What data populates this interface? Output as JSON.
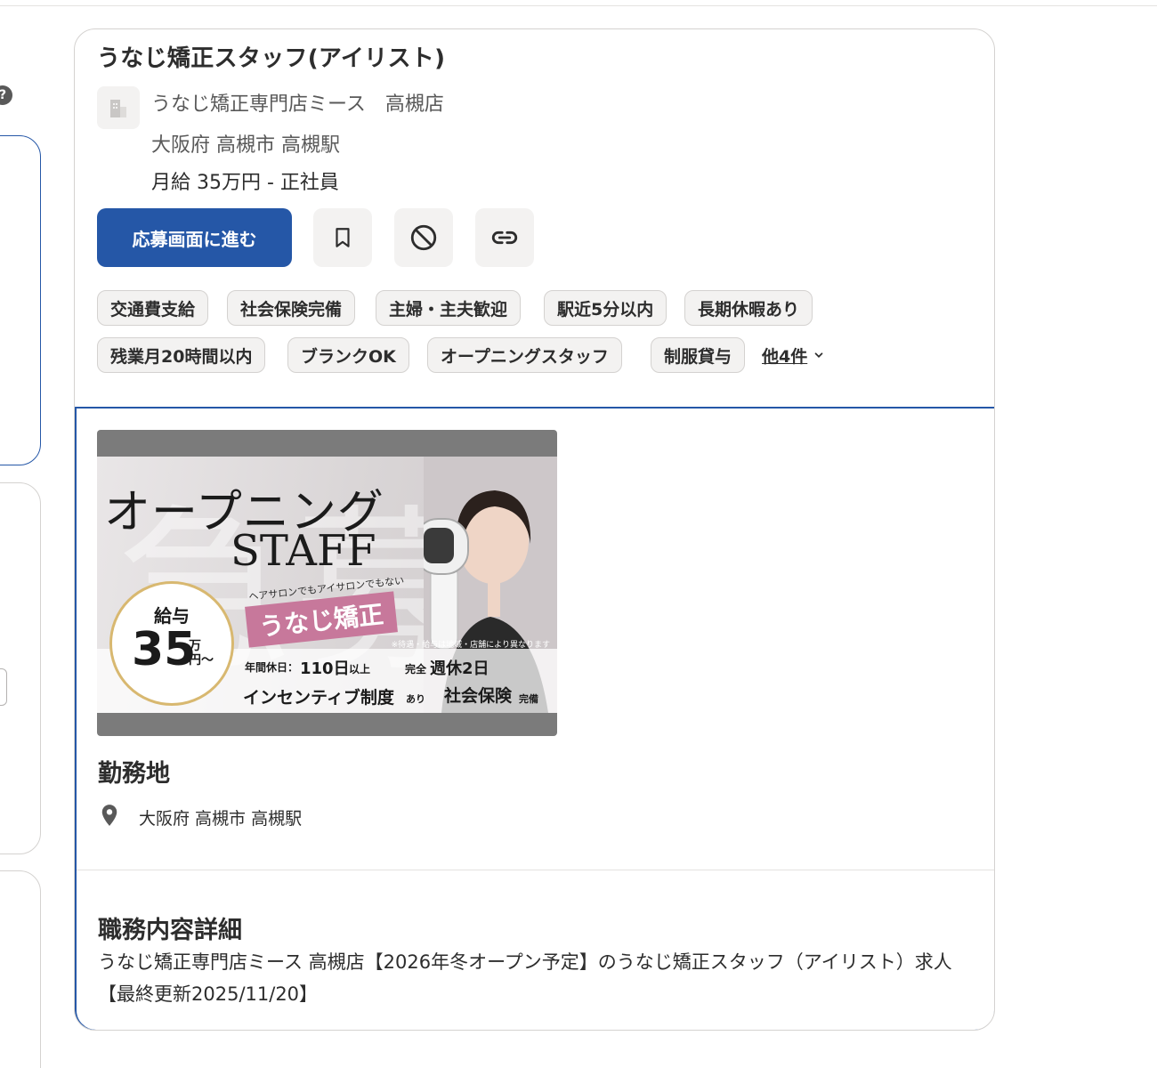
{
  "left_panel": {
    "help_icon": "?"
  },
  "job": {
    "title": "うなじ矯正スタッフ(アイリスト)",
    "company": "うなじ矯正専門店ミース　高槻店",
    "location": "大阪府 高槻市 高槻駅",
    "salary": "月給 35万円  - 正社員"
  },
  "actions": {
    "apply_label": "応募画面に進む",
    "save_icon": "bookmark-icon",
    "block_icon": "not-interested-icon",
    "share_icon": "link-icon"
  },
  "tags": [
    "交通費支給",
    "社会保険完備",
    "主婦・主夫歓迎",
    "駅近5分以内",
    "長期休暇あり",
    "残業月20時間以内",
    "ブランクOK",
    "オープニングスタッフ",
    "制服貸与"
  ],
  "more_tags": "他4件",
  "banner": {
    "headline": "オープニング",
    "staff": "STAFF",
    "sub": "ヘアサロンでもアイサロンでもない",
    "pink": "うなじ矯正",
    "note": "※待遇・給与は地域・店舗により異なります",
    "salary_label": "給与",
    "salary_value": "35",
    "salary_unit_1": "万",
    "salary_unit_2": "円〜",
    "holidays_prefix": "年間休日：",
    "holidays_value": "110日",
    "holidays_suffix": "以上",
    "weekly_prefix": "完全",
    "weekly_value": "週休2日",
    "incentive": "インセンティブ制度",
    "incentive_suffix": "あり",
    "insurance": "社会保険",
    "insurance_suffix": "完備"
  },
  "work_location": {
    "title": "勤務地",
    "icon": "location-pin-icon",
    "text": "大阪府 高槻市 高槻駅"
  },
  "details": {
    "title": "職務内容詳細",
    "text": "うなじ矯正専門店ミース 高槻店【2026年冬オープン予定】のうなじ矯正スタッフ（アイリスト）求人 【最終更新2025/11/20】"
  },
  "colors": {
    "accent": "#2557a7",
    "tag_bg": "#f3f2f1",
    "text": "#2d2d2d",
    "muted": "#595959"
  }
}
